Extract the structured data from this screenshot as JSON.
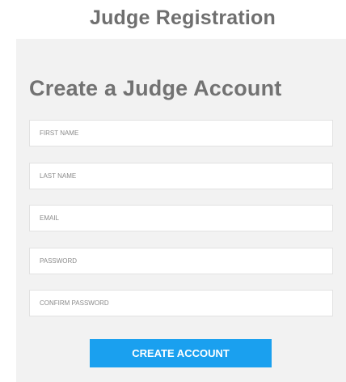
{
  "page": {
    "title": "Judge Registration"
  },
  "form": {
    "heading": "Create a Judge Account",
    "fields": [
      {
        "placeholder": "FIRST NAME",
        "value": ""
      },
      {
        "placeholder": "LAST NAME",
        "value": ""
      },
      {
        "placeholder": "EMAIL",
        "value": ""
      },
      {
        "placeholder": "PASSWORD",
        "value": ""
      },
      {
        "placeholder": "CONFIRM PASSWORD",
        "value": ""
      }
    ],
    "submit_label": "CREATE ACCOUNT"
  },
  "colors": {
    "panel_background": "#f2f2f2",
    "button": "#1aa0ef",
    "heading_text": "#727272"
  }
}
